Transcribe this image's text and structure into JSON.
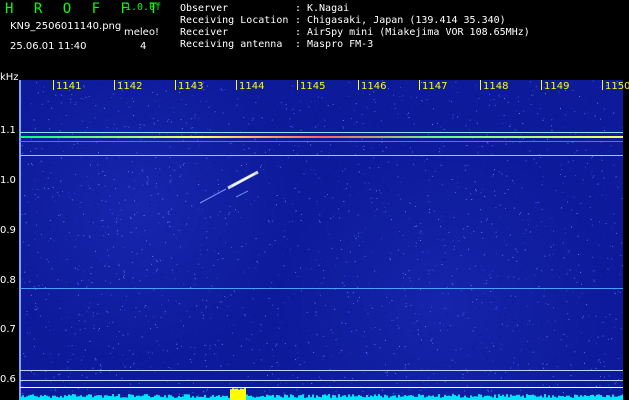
{
  "header": {
    "logo": "H R O F F T",
    "version": "1.0.0f",
    "filename": "KN9_2506011140.png",
    "meleo_label": "meleo!",
    "timestamp": "25.06.01 11:40",
    "count": "4",
    "info": [
      {
        "label": "Observer",
        "value": "K.Nagai"
      },
      {
        "label": "Receiving Location",
        "value": "Chigasaki, Japan (139.414 35.340)"
      },
      {
        "label": "Receiver",
        "value": "AirSpy mini (Miakejima VOR 108.65MHz)"
      },
      {
        "label": "Receiving antenna",
        "value": "Maspro FM-3"
      }
    ],
    "separator": ":"
  },
  "axis": {
    "unit": "kHz",
    "y_labels": [
      "1.1",
      "1.0",
      "0.9",
      "0.8",
      "0.7",
      "0.6"
    ],
    "x_labels": [
      "1141",
      "1142",
      "1143",
      "1144",
      "1145",
      "1146",
      "1147",
      "1148",
      "1149",
      "1150"
    ]
  },
  "colors": {
    "background": "#0d1a9a",
    "header_green": "#00ff00",
    "axis_yellow": "#ffff00",
    "signal_cyan": "#00e5ff",
    "meteor_yellow": "#ffff00"
  }
}
